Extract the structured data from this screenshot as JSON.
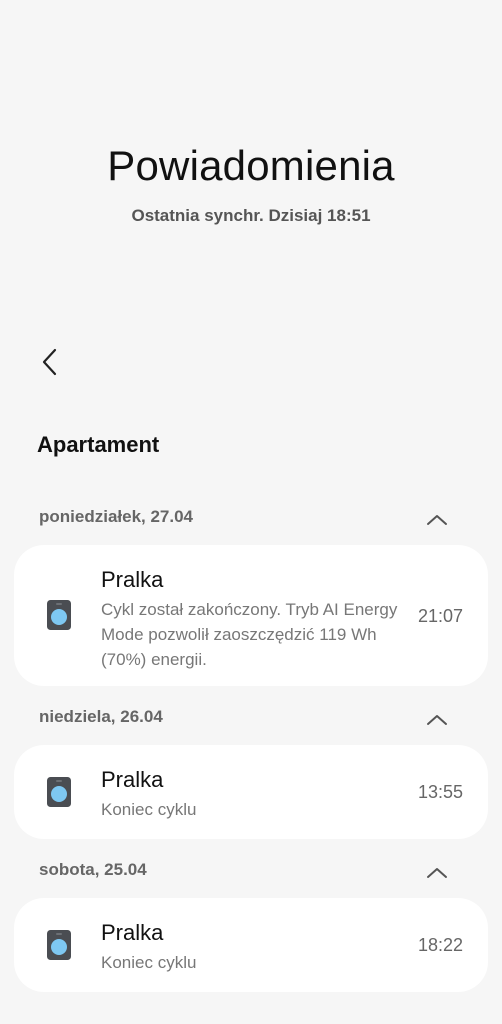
{
  "header": {
    "title": "Powiadomienia",
    "subtitle": "Ostatnia synchr. Dzisiaj 18:51"
  },
  "back_icon": "chevron-left-icon",
  "section": {
    "title": "Apartament"
  },
  "groups": [
    {
      "date": "poniedziałek, 27.04",
      "collapse_icon": "chevron-up-icon",
      "notification": {
        "icon": "washer-icon",
        "title": "Pralka",
        "body": "Cykl został zakończony. Tryb AI Energy Mode pozwolił zaoszczędzić 119 Wh (70%) energii.",
        "time": "21:07"
      }
    },
    {
      "date": "niedziela, 26.04",
      "collapse_icon": "chevron-up-icon",
      "notification": {
        "icon": "washer-icon",
        "title": "Pralka",
        "body": "Koniec cyklu",
        "time": "13:55"
      }
    },
    {
      "date": "sobota, 25.04",
      "collapse_icon": "chevron-up-icon",
      "notification": {
        "icon": "washer-icon",
        "title": "Pralka",
        "body": "Koniec cyklu",
        "time": "18:22"
      }
    }
  ],
  "colors": {
    "background": "#f6f6f6",
    "card": "#ffffff",
    "icon_body": "#4a4d52",
    "icon_window": "#7ec8f2"
  }
}
